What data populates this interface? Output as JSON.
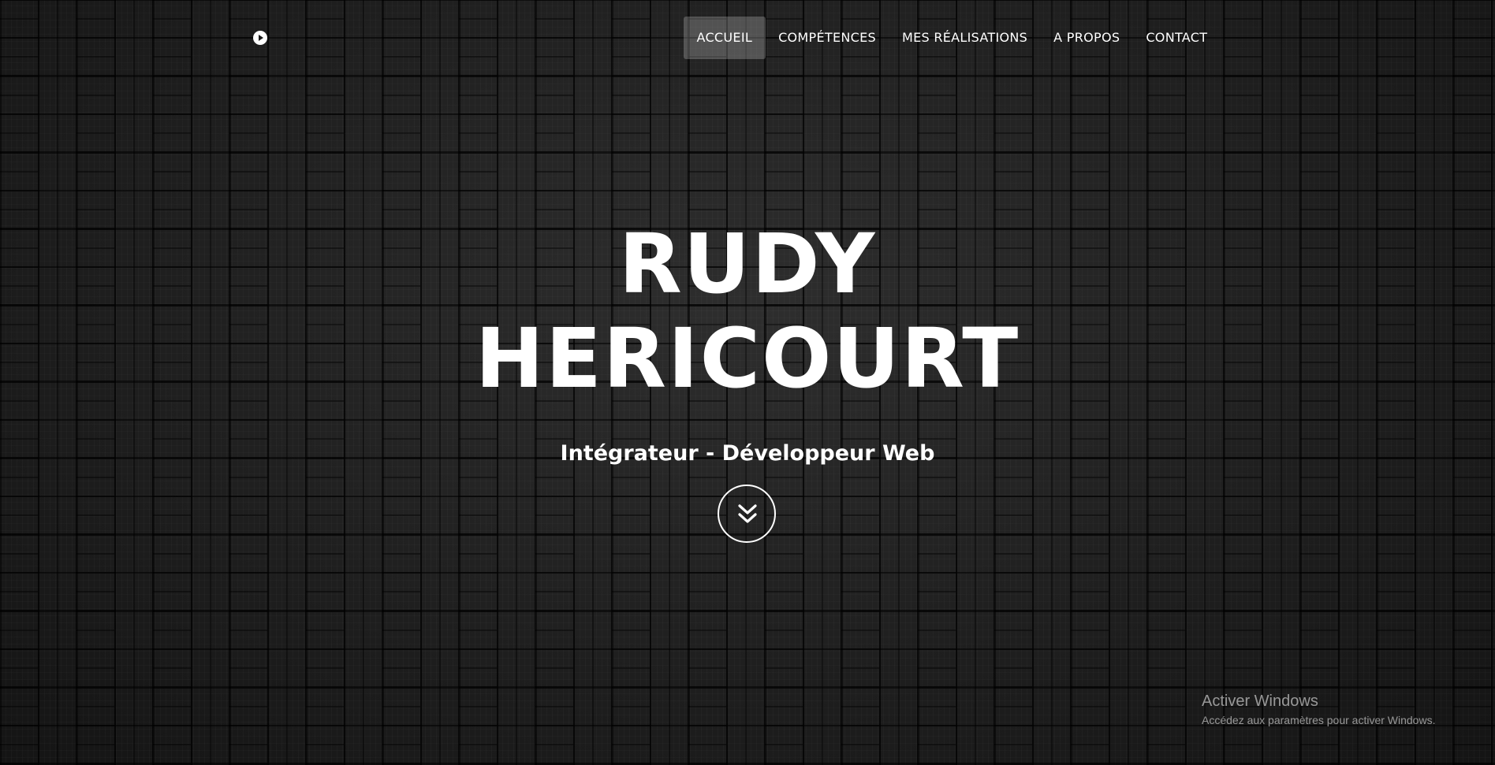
{
  "header": {
    "logo_icon": "play-circle-icon",
    "nav": [
      {
        "label": "ACCUEIL",
        "active": true
      },
      {
        "label": "COMPÉTENCES",
        "active": false
      },
      {
        "label": "MES RÉALISATIONS",
        "active": false
      },
      {
        "label": "A PROPOS",
        "active": false
      },
      {
        "label": "CONTACT",
        "active": false
      }
    ]
  },
  "hero": {
    "name_line1": "RUDY",
    "name_line2": "HERICOURT",
    "subtitle": "Intégrateur - Développeur Web",
    "scroll_icon": "double-chevron-down-icon"
  },
  "watermark": {
    "title": "Activer Windows",
    "subtitle": "Accédez aux paramètres pour activer Windows."
  },
  "colors": {
    "background": "#1d1d1d",
    "text": "#ffffff",
    "nav_active_bg": "rgba(255,255,255,0.22)"
  }
}
